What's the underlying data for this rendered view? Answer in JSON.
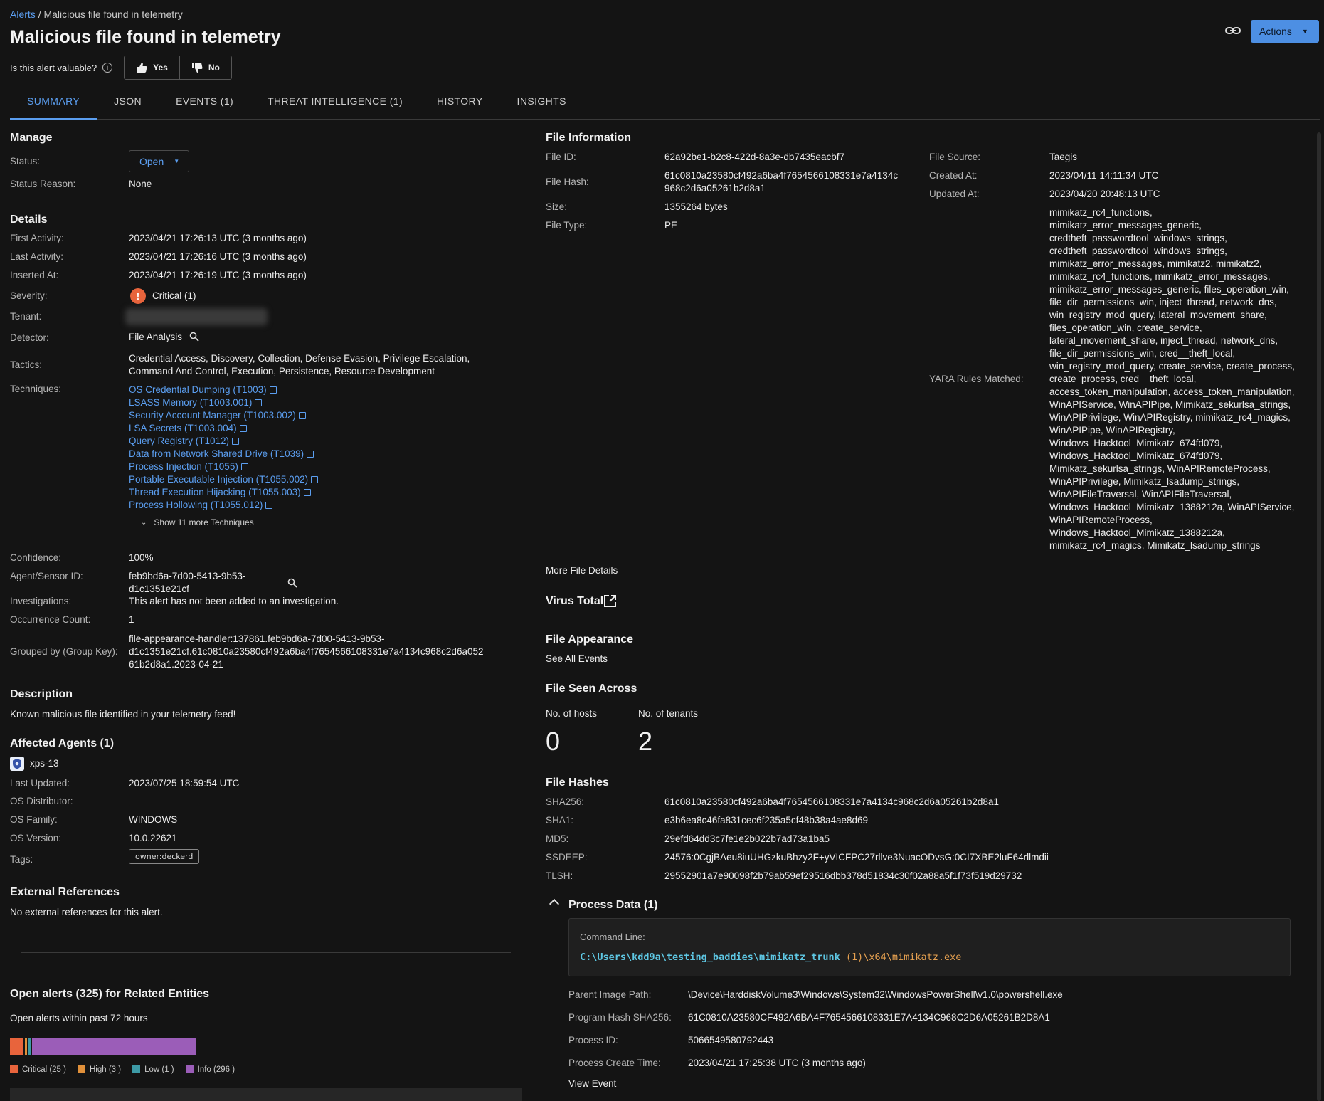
{
  "breadcrumb": {
    "root": "Alerts",
    "sep": "/",
    "current": "Malicious file found in telemetry"
  },
  "title": "Malicious file found in telemetry",
  "valuable": {
    "question": "Is this alert valuable?",
    "yes": "Yes",
    "no": "No"
  },
  "actions_label": "Actions",
  "tabs": [
    "SUMMARY",
    "JSON",
    "EVENTS (1)",
    "THREAT INTELLIGENCE (1)",
    "HISTORY",
    "INSIGHTS"
  ],
  "manage": {
    "heading": "Manage",
    "status_label": "Status:",
    "status_value": "Open",
    "reason_label": "Status Reason:",
    "reason_value": "None"
  },
  "details": {
    "heading": "Details",
    "first_activity_label": "First Activity:",
    "first_activity": "2023/04/21 17:26:13 UTC (3 months ago)",
    "last_activity_label": "Last Activity:",
    "last_activity": "2023/04/21 17:26:16 UTC (3 months ago)",
    "inserted_label": "Inserted At:",
    "inserted": "2023/04/21 17:26:19 UTC (3 months ago)",
    "severity_label": "Severity:",
    "severity": "Critical (1)",
    "tenant_label": "Tenant:",
    "detector_label": "Detector:",
    "detector": "File Analysis",
    "tactics_label": "Tactics:",
    "tactics_line1": "Credential Access, Discovery, Collection, Defense Evasion, Privilege Escalation,",
    "tactics_line2": "Command And Control, Execution, Persistence, Resource Development",
    "techniques_label": "Techniques:",
    "techniques": [
      "OS Credential Dumping (T1003)",
      "LSASS Memory (T1003.001)",
      "Security Account Manager (T1003.002)",
      "LSA Secrets (T1003.004)",
      "Query Registry (T1012)",
      "Data from Network Shared Drive (T1039)",
      "Process Injection (T1055)",
      "Portable Executable Injection (T1055.002)",
      "Thread Execution Hijacking (T1055.003)",
      "Process Hollowing (T1055.012)"
    ],
    "show_more": "Show 11 more Techniques",
    "confidence_label": "Confidence:",
    "confidence": "100%",
    "agent_label": "Agent/Sensor ID:",
    "agent_line1": "feb9bd6a-7d00-5413-9b53-",
    "agent_line2": "d1c1351e21cf",
    "investigations_label": "Investigations:",
    "investigations": "This alert has not been added to an investigation.",
    "occurrence_label": "Occurrence Count:",
    "occurrence": "1",
    "grouped_label": "Grouped by (Group Key):",
    "grouped_line1": "file-appearance-handler:137861.feb9bd6a-7d00-5413-9b53-",
    "grouped_line2": "d1c1351e21cf.61c0810a23580cf492a6ba4f7654566108331e7a4134c968c2d6a052",
    "grouped_line3": "61b2d8a1.2023-04-21"
  },
  "description": {
    "heading": "Description",
    "text": "Known malicious file identified in your telemetry feed!"
  },
  "affected": {
    "heading": "Affected Agents  (1)",
    "agent": "xps-13",
    "last_updated_label": "Last Updated:",
    "last_updated": "2023/07/25 18:59:54 UTC",
    "distributor_label": "OS Distributor:",
    "family_label": "OS Family:",
    "family": "WINDOWS",
    "version_label": "OS Version:",
    "version": "10.0.22621",
    "tags_label": "Tags:",
    "tag": "owner:deckerd"
  },
  "external": {
    "heading": "External References",
    "text": "No external references for this alert."
  },
  "related": {
    "heading": "Open alerts (325) for Related Entities",
    "sub": "Open alerts within past 72 hours",
    "legend": [
      {
        "label": "Critical (25 )",
        "color": "#e8643c",
        "count": 25
      },
      {
        "label": "High (3 )",
        "color": "#e0903a",
        "count": 3
      },
      {
        "label": "Low (1 )",
        "color": "#3d9aa6",
        "count": 1
      },
      {
        "label": "Info (296 )",
        "color": "#9b5db8",
        "count": 296
      }
    ]
  },
  "file_info": {
    "heading": "File Information",
    "id_label": "File ID:",
    "id": "62a92be1-b2c8-422d-8a3e-db7435eacbf7",
    "hash_label": "File Hash:",
    "hash_line1": "61c0810a23580cf492a6ba4f7654566108331e7a4134c",
    "hash_line2": "968c2d6a05261b2d8a1",
    "size_label": "Size:",
    "size": "1355264 bytes",
    "type_label": "File Type:",
    "type": "PE",
    "source_label": "File Source:",
    "source": "Taegis",
    "created_label": "Created At:",
    "created": "2023/04/11 14:11:34 UTC",
    "updated_label": "Updated At:",
    "updated": "2023/04/20 20:48:13 UTC",
    "yara_label": "YARA Rules Matched:",
    "yara_lines": [
      "mimikatz_rc4_functions,",
      "mimikatz_error_messages_generic,",
      "credtheft_passwordtool_windows_strings,",
      "credtheft_passwordtool_windows_strings,",
      "mimikatz_error_messages, mimikatz2, mimikatz2,",
      "mimikatz_rc4_functions, mimikatz_error_messages,",
      "mimikatz_error_messages_generic, files_operation_win,",
      "file_dir_permissions_win, inject_thread, network_dns,",
      "win_registry_mod_query, lateral_movement_share,",
      "files_operation_win, create_service,",
      "lateral_movement_share, inject_thread, network_dns,",
      "file_dir_permissions_win, cred__theft_local,",
      "win_registry_mod_query, create_service, create_process,",
      "create_process, cred__theft_local,",
      "access_token_manipulation, access_token_manipulation,",
      "WinAPIService, WinAPIPipe, Mimikatz_sekurlsa_strings,",
      "WinAPIPrivilege, WinAPIRegistry, mimikatz_rc4_magics,",
      "WinAPIPipe, WinAPIRegistry,",
      "Windows_Hacktool_Mimikatz_674fd079,",
      "Windows_Hacktool_Mimikatz_674fd079,",
      "Mimikatz_sekurlsa_strings, WinAPIRemoteProcess,",
      "WinAPIPrivilege, Mimikatz_lsadump_strings,",
      "WinAPIFileTraversal, WinAPIFileTraversal,",
      "Windows_Hacktool_Mimikatz_1388212a, WinAPIService,",
      "WinAPIRemoteProcess,",
      "Windows_Hacktool_Mimikatz_1388212a,",
      "mimikatz_rc4_magics, Mimikatz_lsadump_strings"
    ],
    "more": "More File Details"
  },
  "virus_total": "Virus Total",
  "appearance": {
    "heading": "File Appearance",
    "link": "See All Events"
  },
  "seen": {
    "heading": "File Seen Across",
    "hosts_label": "No. of hosts",
    "hosts": "0",
    "tenants_label": "No. of tenants",
    "tenants": "2"
  },
  "hashes": {
    "heading": "File Hashes",
    "sha256_label": "SHA256:",
    "sha256": "61c0810a23580cf492a6ba4f7654566108331e7a4134c968c2d6a05261b2d8a1",
    "sha1_label": "SHA1:",
    "sha1": "e3b6ea8c46fa831cec6f235a5cf48b38a4ae8d69",
    "md5_label": "MD5:",
    "md5": "29efd64dd3c7fe1e2b022b7ad73a1ba5",
    "ssdeep_label": "SSDEEP:",
    "ssdeep": "24576:0CgjBAeu8iuUHGzkuBhzy2F+yVICFPC27rllve3NuacODvsG:0CI7XBE2luF64rllmdii",
    "tlsh_label": "TLSH:",
    "tlsh": "29552901a7e90098f2b79ab59ef29516dbb378d51834c30f02a88a5f1f73f519d29732"
  },
  "process": {
    "heading": "Process Data (1)",
    "cmd_label": "Command Line:",
    "cmd_a": "C:\\Users\\kdd9a\\testing_baddies\\mimikatz_trunk",
    "cmd_b": " (1)",
    "cmd_c": "\\x64\\mimikatz.exe",
    "parent_label": "Parent Image Path:",
    "parent": "\\Device\\HarddiskVolume3\\Windows\\System32\\WindowsPowerShell\\v1.0\\powershell.exe",
    "phash_label": "Program Hash SHA256:",
    "phash": "61C0810A23580CF492A6BA4F7654566108331E7A4134C968C2D6A05261B2D8A1",
    "pid_label": "Process ID:",
    "pid": "5066549580792443",
    "ctime_label": "Process Create Time:",
    "ctime": "2023/04/21 17:25:38 UTC (3 months ago)",
    "view": "View Event"
  }
}
